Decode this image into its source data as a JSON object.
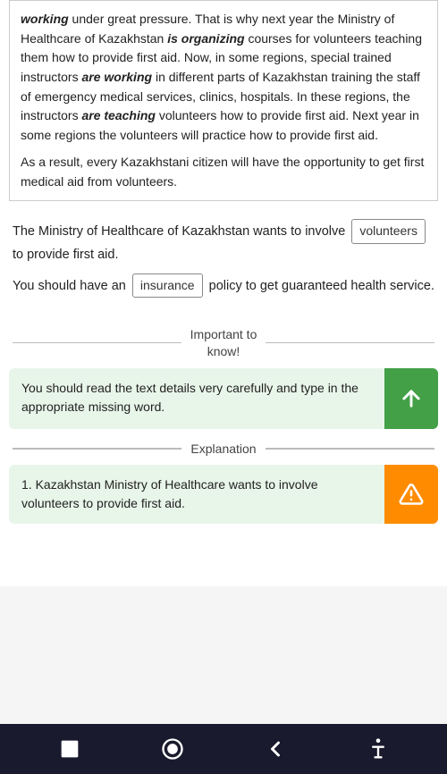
{
  "textblock": {
    "paragraph1": "working under great pressure. That is why next year the Ministry of Healthcare of Kazakhstan is organizing courses for volunteers teaching them how to provide first aid. Now, in some regions, special trained instructors are working in different parts of Kazakhstan training the staff of emergency medical services, clinics, hospitals. In these regions, the instructors are teaching volunteers how to provide first aid. Next year in some regions the volunteers will practice how to provide first aid.",
    "paragraph1_bold_words": [
      "working",
      "is organizing",
      "are working",
      "are teaching"
    ],
    "paragraph2": "As a result, every Kazakhstani citizen will have the opportunity to get first medical aid from volunteers."
  },
  "fill_sentences": {
    "sentence1_before": "The Ministry of Healthcare of Kazakhstan wants to involve",
    "sentence1_word": "volunteers",
    "sentence1_after": "to provide first aid.",
    "sentence2_before": "You should have an",
    "sentence2_word": "insurance",
    "sentence2_after": "policy to get guaranteed health service."
  },
  "important_divider": {
    "text": "Important to\nknow!"
  },
  "info_box": {
    "text": "You should read the text details very carefully and type in the appropriate missing word.",
    "button_icon": "arrow-up"
  },
  "explanation_divider": {
    "text": "Explanation"
  },
  "explanation_box": {
    "text": "1. Kazakhstan Ministry of Healthcare wants to involve volunteers to provide first aid.",
    "button_icon": "warning"
  },
  "bottom_nav": {
    "items": [
      {
        "icon": "stop-square",
        "label": "Stop"
      },
      {
        "icon": "home-circle",
        "label": "Home"
      },
      {
        "icon": "back-arrow",
        "label": "Back"
      },
      {
        "icon": "accessibility",
        "label": "Accessibility"
      }
    ]
  }
}
